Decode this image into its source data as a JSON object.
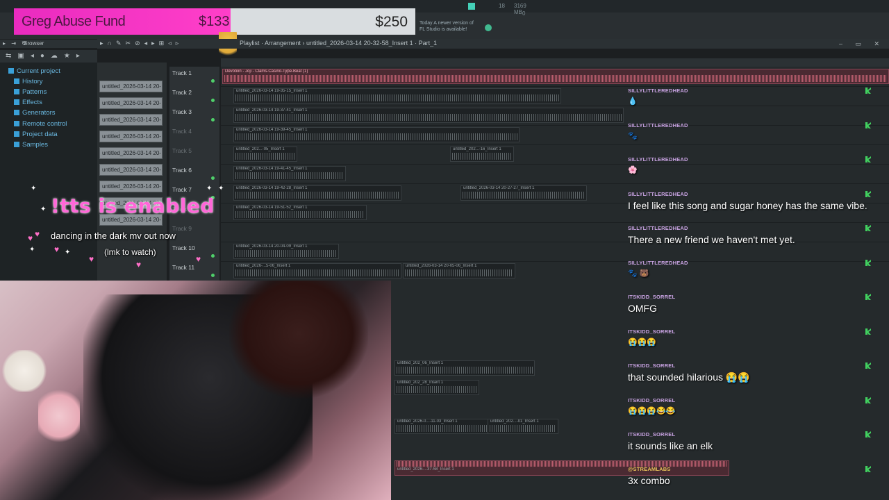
{
  "fund": {
    "title": "Greg Abuse Fund",
    "raised": "$133",
    "goal": "$250"
  },
  "update_note": {
    "line1": "Today  A newer version of",
    "line2": "FL Studio is available!"
  },
  "meters": {
    "cpu": "18",
    "ram": "3169 MB",
    "voices": "0"
  },
  "browser": {
    "label": "Browser",
    "items": [
      "Current project",
      "History",
      "Patterns",
      "Effects",
      "Generators",
      "Remote control",
      "Project data",
      "Samples"
    ]
  },
  "playlist": {
    "breadcrumb": "Playlist · Arrangement › untitled_2026-03-14 20-32-58_Insert 1 · Part_1"
  },
  "patterns": [
    "untitled_2026-03-14 20-",
    "untitled_2026-03-14 20-",
    "untitled_2026-03-14 20-",
    "untitled_2026-03-14 20-",
    "untitled_2026-03-14 20-",
    "untitled_2026-03-14 20-",
    "untitled_2026-03-14 20-",
    "untitled_2026-03-14 20-",
    "untitled_2026-03-14 20-"
  ],
  "tracks": [
    "Track 1",
    "Track 2",
    "Track 3",
    "Track 4",
    "Track 5",
    "Track 6",
    "Track 7",
    "Track 8",
    "Track 9",
    "Track 10",
    "Track 11"
  ],
  "clips": {
    "top": "Devotion - Joji - Clams-Casino-Type-Beat (1)",
    "c1": "untitled_2026-03-14 19-35-15_Insert 1",
    "c2": "untitled_2026-03-14 19-37-41_Insert 1",
    "c3": "untitled_2026-03-14 19-39-45_Insert 1",
    "c4": "untitled_202...-05_Insert 1",
    "c5": "untitled_202...-16_Insert 1",
    "c6": "untitled_2026-03-14 19-41-45_Insert 1",
    "c7": "untitled_2026-03-14 19-42-28_Insert 1",
    "c8": "untitled_2026-03-14 20-27-27_Insert 1",
    "c9": "untitled_2026-03-14 19-51-52_Insert 1",
    "c10": "untitled_2026-03-14 20-04-09_Insert 1",
    "c11": "untitled_2026-...5-06_Insert 1",
    "c12": "untitled_2026-03-14 20-05-06_Insert 1",
    "c13": "untitled_202_06_Insert 1",
    "c14": "untitled_202_28_Insert 1",
    "c15": "untitled_2026-0...-11-03_Insert 1",
    "c16": "untitled_202...-01_Insert 1",
    "c17": "untitled_2026-...37-58_Insert 1"
  },
  "overlay": {
    "tts": "!tts is enabled",
    "mv": "dancing in the dark mv out now",
    "mv2": "(lmk to watch)"
  },
  "chat": [
    {
      "user": "SILLYLITTLEREDHEAD",
      "text": "💧"
    },
    {
      "user": "SILLYLITTLEREDHEAD",
      "text": "🐾"
    },
    {
      "user": "SILLYLITTLEREDHEAD",
      "text": "🌸"
    },
    {
      "user": "SILLYLITTLEREDHEAD",
      "text": "I feel like this song and sugar honey has the same vibe."
    },
    {
      "user": "SILLYLITTLEREDHEAD",
      "text": "There a new friend we haven't met yet."
    },
    {
      "user": "SILLYLITTLEREDHEAD",
      "text": "🐾 🐻"
    },
    {
      "user": "ITSKIDD_SORREL",
      "text": "OMFG"
    },
    {
      "user": "ITSKIDD_SORREL",
      "text": "😭😭😭"
    },
    {
      "user": "ITSKIDD_SORREL",
      "text": "that sounded hilarious 😭😭"
    },
    {
      "user": "ITSKIDD_SORREL",
      "text": "😭😭😭😂😂"
    },
    {
      "user": "ITSKIDD_SORREL",
      "text": "it sounds like an elk"
    },
    {
      "user": "@STREAMLABS",
      "text": "3x    combo"
    }
  ],
  "colors": {
    "accent_pink": "#ff3fc9",
    "chat_user": "#c9a3e3",
    "mod_badge": "#41d05f",
    "clip_pink": "#d36a7c"
  }
}
